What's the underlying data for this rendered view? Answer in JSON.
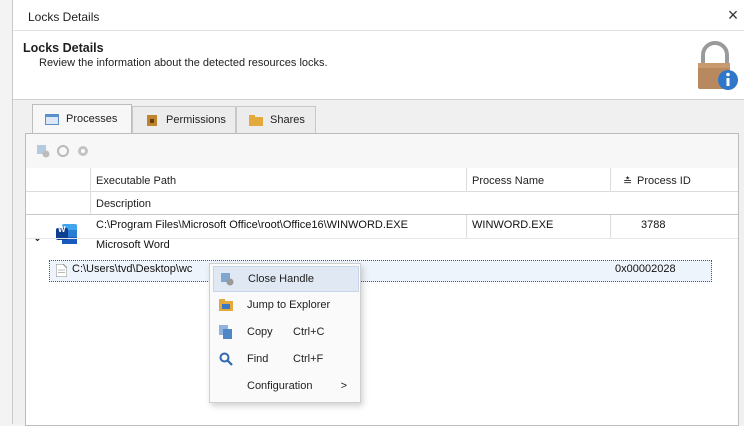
{
  "window": {
    "title": "Locks Details",
    "close_glyph": "×"
  },
  "header": {
    "title": "Locks Details",
    "description": "Review the information about the detected resources locks.",
    "icon": "padlock-info-icon"
  },
  "tabs": [
    {
      "label": "Processes",
      "icon": "processes-icon",
      "active": true
    },
    {
      "label": "Permissions",
      "icon": "permissions-icon",
      "active": false
    },
    {
      "label": "Shares",
      "icon": "shares-icon",
      "active": false
    }
  ],
  "toolbar": [
    "close-handle-icon",
    "refresh-icon",
    "settings-icon"
  ],
  "grid": {
    "columns": {
      "path": "Executable Path",
      "description": "Description",
      "process_name": "Process Name",
      "process_id": "Process ID",
      "sort_glyph": "≛"
    },
    "process": {
      "expand_glyph": "⌄",
      "path": "C:\\Program Files\\Microsoft Office\\root\\Office16\\WINWORD.EXE",
      "name": "WINWORD.EXE",
      "pid": "3788",
      "description": "Microsoft Word",
      "app_icon_letter": "W"
    },
    "handle": {
      "path": "C:\\Users\\tvd\\Desktop\\wc",
      "value": "0x00002028"
    }
  },
  "context_menu": {
    "items": [
      {
        "label": "Close Handle",
        "icon": "close-handle-icon"
      },
      {
        "label": "Jump to Explorer",
        "icon": "explorer-icon"
      },
      {
        "label": "Copy",
        "shortcut": "Ctrl+C",
        "icon": "copy-icon"
      },
      {
        "label": "Find",
        "shortcut": "Ctrl+F",
        "icon": "search-icon"
      },
      {
        "label": "Configuration",
        "submenu_glyph": ">"
      }
    ]
  }
}
